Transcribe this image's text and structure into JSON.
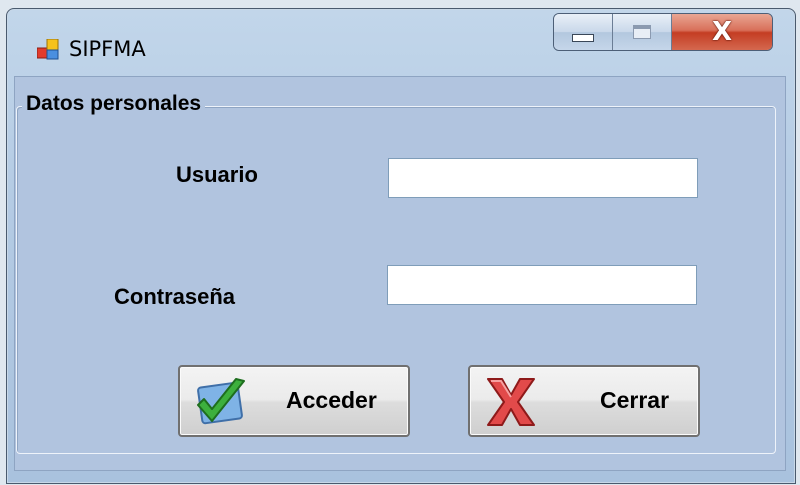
{
  "window": {
    "title": "SIPFMA",
    "controls": {
      "minimize": "minimize",
      "maximize": "maximize",
      "close": "X"
    }
  },
  "form": {
    "group_title": "Datos personales",
    "user_label": "Usuario",
    "user_value": "",
    "password_label": "Contraseña",
    "password_value": ""
  },
  "buttons": {
    "acceder_label": "Acceder",
    "cerrar_label": "Cerrar"
  },
  "icons": {
    "app": "app-window-icon",
    "acceder": "checkmark-icon",
    "cerrar": "red-x-icon"
  },
  "colors": {
    "client_background": "#b1c4df",
    "close_button": "#c43d23",
    "checkmark": "#3db03d",
    "cross": "#d93a3a"
  }
}
